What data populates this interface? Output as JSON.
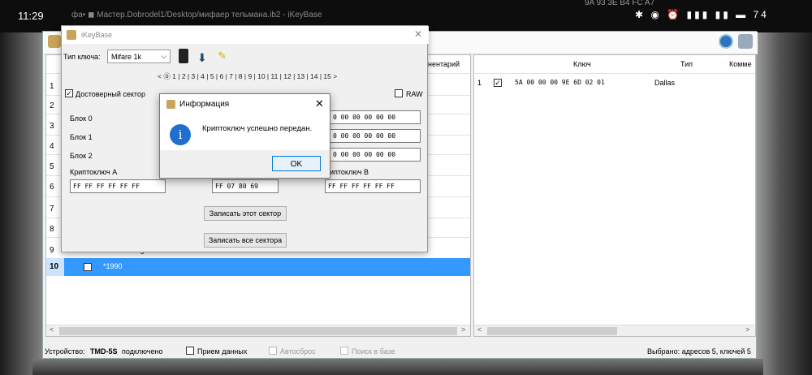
{
  "status_bar": {
    "time": "11:29",
    "icons": "✱ ◉ ⏰ ▮▮▮ ▮▮ ▬ 74",
    "bg_text": "фа• ◼ Мастер.Dobrodel1/Desktop/мифаер тельмана.ib2 - iKeyBase",
    "bg_text_top": "9A 93 3E B4 FC A7"
  },
  "app": {
    "left_header": "нентарий",
    "left_rows": [
      "1",
      "2",
      "3",
      "4",
      "5",
      "6",
      "7",
      "8",
      "9",
      "10"
    ],
    "left_row9_text": "*1990g",
    "selected_row": {
      "num": "10",
      "text": "*1990"
    },
    "right_headers": {
      "key": "Ключ",
      "type": "Тип",
      "comment": "Комме"
    },
    "right_rows": [
      {
        "num": "1",
        "key": "5A 00 00 00 9E 6D 02 01",
        "type": "Dallas"
      }
    ],
    "status": {
      "device_label": "Устройство:",
      "device_name": "TMD-5S",
      "device_state": "подключено",
      "receive": "Прием данных",
      "autoreset": "Автосброс",
      "search": "Поиск в базе",
      "selected": "Выбрано: адресов 5, ключей 5"
    }
  },
  "ikey": {
    "title": "iKeyBase",
    "key_type_label": "Тип ключа:",
    "key_type_value": "Mifare 1k",
    "sector_nav": "< ⓪ 1 | 2 | 3 | 4 | 5 | 6 | 7 | 8 | 9 | 10 | 11 | 12 | 13 | 14 | 15 >",
    "trusted_sector": "Достоверный сектор",
    "raw": "RAW",
    "block0": "Блок 0",
    "block1": "Блок 1",
    "block2": "Блок 2",
    "block0_tail": "0 00 00 00 00 00",
    "block1_tail": "0 00 00 00 00 00",
    "block2_tail": "0 00 00 00 00 00",
    "crypto_a_label": "Криптоключ A",
    "crypto_b_label": "иптоключ B",
    "crypto_a": "FF FF FF FF FF FF",
    "access": "FF 07 80 69",
    "crypto_b": "FF FF FF FF FF FF",
    "write_sector": "Записать этот сектор",
    "write_all": "Записать все сектора"
  },
  "info": {
    "title": "Информация",
    "message": "Криптоключ успешно передан.",
    "ok": "OK"
  }
}
